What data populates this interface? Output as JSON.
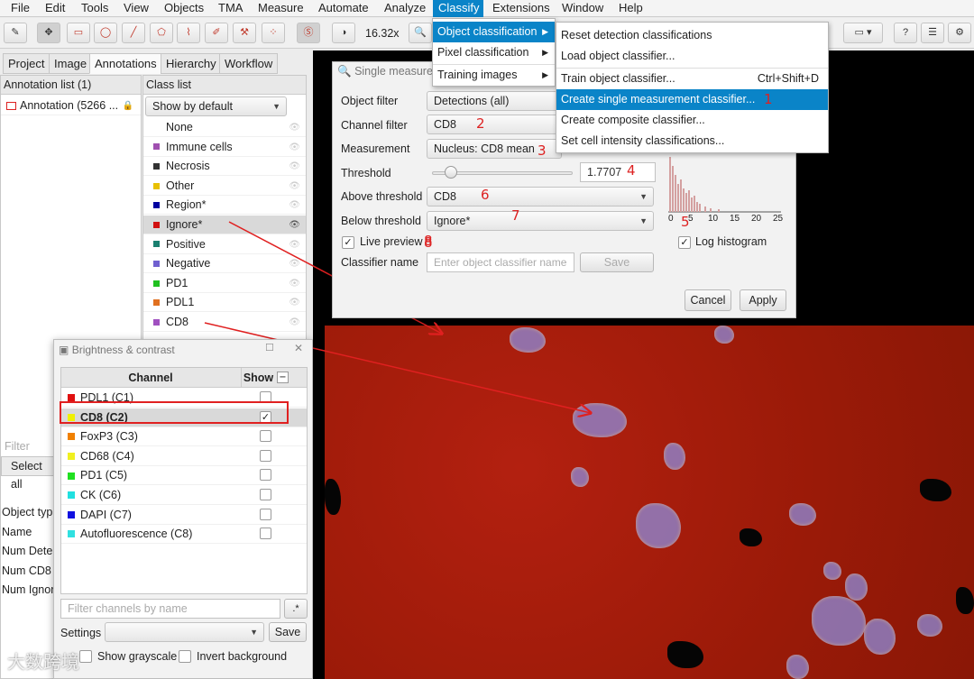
{
  "menubar": {
    "items": [
      "File",
      "Edit",
      "Tools",
      "View",
      "Objects",
      "TMA",
      "Measure",
      "Automate",
      "Analyze",
      "Classify",
      "Extensions",
      "Window",
      "Help"
    ],
    "active": "Classify"
  },
  "toolbar": {
    "zoom": "16.32x"
  },
  "tabs": [
    "Project",
    "Image",
    "Annotations",
    "Hierarchy",
    "Workflow"
  ],
  "annotation_list": {
    "header": "Annotation list (1)",
    "items": [
      "Annotation (5266 ..."
    ]
  },
  "class_list": {
    "header": "Class list",
    "filter": "Show by default",
    "items": [
      {
        "name": "None",
        "color": "#ffffff"
      },
      {
        "name": "Immune cells",
        "color": "#a050b0"
      },
      {
        "name": "Necrosis",
        "color": "#333333"
      },
      {
        "name": "Other",
        "color": "#e8c000"
      },
      {
        "name": "Region*",
        "color": "#0000a0"
      },
      {
        "name": "Ignore*",
        "color": "#d01010"
      },
      {
        "name": "Positive",
        "color": "#1a8070"
      },
      {
        "name": "Negative",
        "color": "#7060d0"
      },
      {
        "name": "PD1",
        "color": "#20c020"
      },
      {
        "name": "PDL1",
        "color": "#e07020"
      },
      {
        "name": "CD8",
        "color": "#a050c0"
      }
    ]
  },
  "left_bottom": {
    "filter_placeholder": "Filter anno",
    "select_all": "Select all",
    "props": [
      "Object typ",
      "Name",
      "Num Dete",
      "Num CD8",
      "Num Ignor"
    ]
  },
  "classify_menu": {
    "items": [
      "Object classification",
      "Pixel classification",
      "Training images"
    ]
  },
  "object_class_menu": {
    "items": [
      "Reset detection classifications",
      "Load object classifier...",
      "Train object classifier...",
      "Create single measurement classifier...",
      "Create composite classifier...",
      "Set cell intensity classifications..."
    ],
    "shortcut": "Ctrl+Shift+D"
  },
  "single_dialog": {
    "title": "Single measureme",
    "object_filter_label": "Object filter",
    "object_filter": "Detections (all)",
    "channel_filter_label": "Channel filter",
    "channel_filter": "CD8",
    "measurement_label": "Measurement",
    "measurement": "Nucleus: CD8 mean",
    "threshold_label": "Threshold",
    "threshold": "1.7707",
    "threshold_fraction": 0.07,
    "above_label": "Above threshold",
    "above": "CD8",
    "below_label": "Below threshold",
    "below": "Ignore*",
    "live_preview": "Live preview",
    "live_preview_checked": true,
    "classifier_name_label": "Classifier name",
    "classifier_name_placeholder": "Enter object classifier name",
    "save": "Save",
    "cancel": "Cancel",
    "apply": "Apply",
    "log_histogram": "Log histogram",
    "log_histogram_checked": true,
    "hist_ticks": [
      "0",
      "5",
      "10",
      "15",
      "20",
      "25"
    ]
  },
  "annotations": [
    "1",
    "2",
    "3",
    "4",
    "5",
    "6",
    "7",
    "8"
  ],
  "brightness": {
    "title": "Brightness & contrast",
    "col_channel": "Channel",
    "col_show": "Show",
    "channels": [
      {
        "name": "PDL1 (C1)",
        "color": "#e01010",
        "shown": false
      },
      {
        "name": "CD8 (C2)",
        "color": "#f0f000",
        "shown": true
      },
      {
        "name": "FoxP3 (C3)",
        "color": "#f08000",
        "shown": false
      },
      {
        "name": "CD68 (C4)",
        "color": "#f0f020",
        "shown": false
      },
      {
        "name": "PD1 (C5)",
        "color": "#20e020",
        "shown": false
      },
      {
        "name": "CK (C6)",
        "color": "#20e0e0",
        "shown": false
      },
      {
        "name": "DAPI (C7)",
        "color": "#1010e0",
        "shown": false
      },
      {
        "name": "Autofluorescence (C8)",
        "color": "#30e0e0",
        "shown": false
      }
    ],
    "filter_placeholder": "Filter channels by name",
    "settings_label": "Settings",
    "save": "Save",
    "grayscale": "Show grayscale",
    "invert": "Invert background"
  },
  "watermark": "大数跨境"
}
